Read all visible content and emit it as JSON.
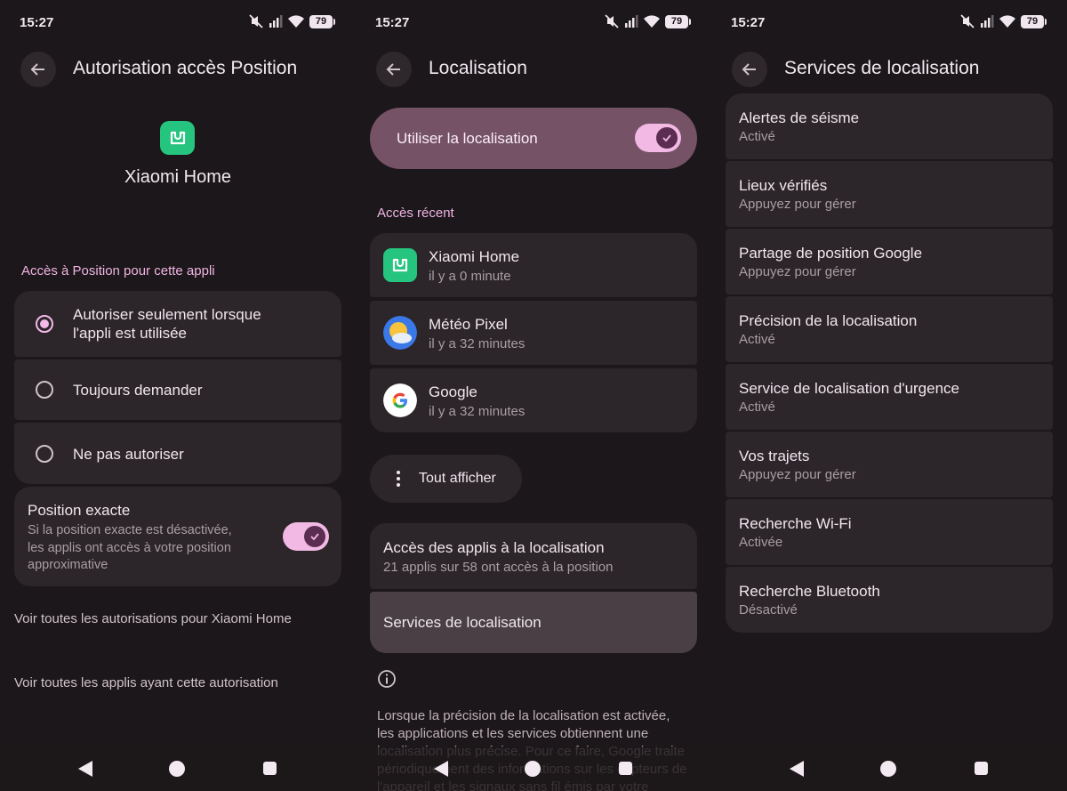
{
  "status": {
    "time": "15:27",
    "battery": "79"
  },
  "panel1": {
    "title": "Autorisation accès Position",
    "app_name": "Xiaomi Home",
    "section": "Accès à Position pour cette appli",
    "options": [
      {
        "label_line1": "Autoriser seulement lorsque",
        "label_line2": "l'appli est utilisée",
        "selected": true
      },
      {
        "label": "Toujours demander",
        "selected": false
      },
      {
        "label": "Ne pas autoriser",
        "selected": false
      }
    ],
    "exact": {
      "title": "Position exacte",
      "desc1": "Si la position exacte est désactivée,",
      "desc2": "les applis ont accès à votre position",
      "desc3": "approximative",
      "enabled": true
    },
    "link1": "Voir toutes les autorisations pour Xiaomi Home",
    "link2": "Voir toutes les applis ayant cette autorisation"
  },
  "panel2": {
    "title": "Localisation",
    "master_label": "Utiliser la localisation",
    "master_enabled": true,
    "recent_label": "Accès récent",
    "recent": [
      {
        "name": "Xiaomi Home",
        "time": "il y a 0 minute",
        "icon": "xiaomi-home-icon"
      },
      {
        "name": "Météo Pixel",
        "time": "il y a 32 minutes",
        "icon": "weather-icon"
      },
      {
        "name": "Google",
        "time": "il y a 32 minutes",
        "icon": "google-icon"
      }
    ],
    "show_all": "Tout afficher",
    "app_access_title": "Accès des applis à la localisation",
    "app_access_sub": "21 applis sur 58 ont accès à la position",
    "services_label": "Services de localisation",
    "info_para": "Lorsque la précision de la localisation est activée, les applications et les services obtiennent une localisation plus précise. Pour ce faire, Google traite périodiquement des informations sur les capteurs de l'appareil et les signaux sans fil émis par votre"
  },
  "panel3": {
    "title": "Services de localisation",
    "items": [
      {
        "title": "Alertes de séisme",
        "sub": "Activé"
      },
      {
        "title": "Lieux vérifiés",
        "sub": "Appuyez pour gérer"
      },
      {
        "title": "Partage de position Google",
        "sub": "Appuyez pour gérer"
      },
      {
        "title": "Précision de la localisation",
        "sub": "Activé"
      },
      {
        "title": "Service de localisation d'urgence",
        "sub": "Activé"
      },
      {
        "title": "Vos trajets",
        "sub": "Appuyez pour gérer"
      },
      {
        "title": "Recherche Wi-Fi",
        "sub": "Activée"
      },
      {
        "title": "Recherche Bluetooth",
        "sub": "Désactivé"
      }
    ]
  },
  "colors": {
    "accent": "#f3b9e8",
    "surface": "#2c2529",
    "background": "#1c171a",
    "master_bg": "#755266",
    "selected_row": "#4a3f45"
  }
}
